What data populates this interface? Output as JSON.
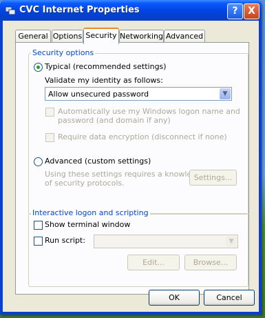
{
  "window": {
    "title": "CVC Internet  Properties",
    "help_glyph": "?",
    "close_glyph": "X"
  },
  "tabs": [
    "General",
    "Options",
    "Security",
    "Networking",
    "Advanced"
  ],
  "security_options": {
    "legend": "Security options",
    "typical_label": "Typical (recommended settings)",
    "validate_label": "Validate my identity as follows:",
    "validate_selected": "Allow unsecured password",
    "auto_logon_label": "Automatically use my Windows logon name and password (and domain if any)",
    "auto_logon_line1": "Automatically use my Windows logon name and",
    "auto_logon_line2": "password (and domain if any)",
    "encryption_label": "Require data encryption (disconnect if none)",
    "advanced_label": "Advanced (custom settings)",
    "advanced_desc_line1": "Using these settings requires a knowledge",
    "advanced_desc_line2": "of security protocols.",
    "settings_button": "Settings..."
  },
  "interactive": {
    "legend": "Interactive logon and scripting",
    "show_terminal_label": "Show terminal window",
    "run_script_label": "Run script:",
    "edit_button": "Edit...",
    "browse_button": "Browse..."
  },
  "footer": {
    "ok": "OK",
    "cancel": "Cancel"
  },
  "icons": {
    "dropdown": "chevron-down-icon",
    "app": "network-connection-icon"
  },
  "colors": {
    "accent_radio": "#21a121",
    "legend": "#0046d5",
    "titlebar": "#0447e6"
  }
}
